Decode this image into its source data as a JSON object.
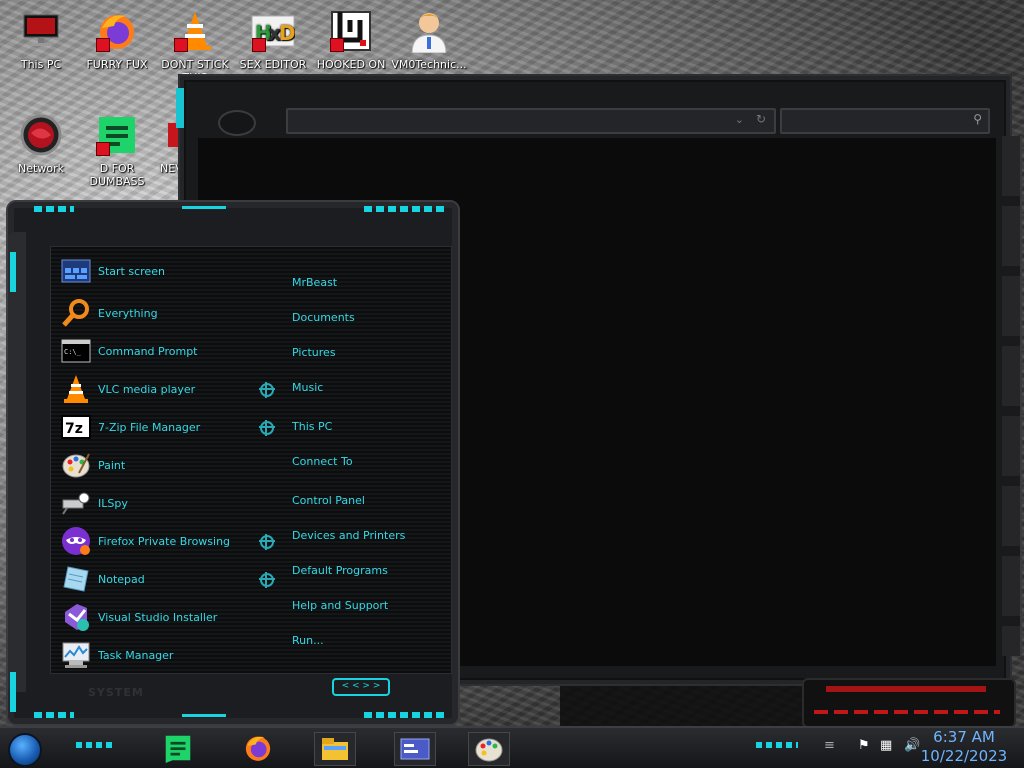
{
  "desktop": {
    "icons": [
      {
        "label": "This PC"
      },
      {
        "label": "FURRY FUX"
      },
      {
        "label": "DONT STICK THIS"
      },
      {
        "label": "SEX EDITOR"
      },
      {
        "label": "HOOKED ON"
      },
      {
        "label": "VM0Technic..."
      },
      {
        "label": "Network"
      },
      {
        "label": "D FOR DUMBASS"
      },
      {
        "label": "NEV"
      }
    ]
  },
  "start_menu": {
    "programs": [
      {
        "label": "Start screen",
        "icon": "start-screen-icon"
      },
      {
        "label": "Everything",
        "icon": "magnifier-icon"
      },
      {
        "label": "Command Prompt",
        "icon": "terminal-icon"
      },
      {
        "label": "VLC media player",
        "icon": "vlc-cone-icon",
        "submenu": true
      },
      {
        "label": "7-Zip File Manager",
        "icon": "7zip-icon",
        "submenu": true
      },
      {
        "label": "Paint",
        "icon": "palette-icon"
      },
      {
        "label": "ILSpy",
        "icon": "ilspy-icon"
      },
      {
        "label": "Firefox Private Browsing",
        "icon": "private-mask-icon",
        "submenu": true
      },
      {
        "label": "Notepad",
        "icon": "notepad-icon",
        "submenu": true
      },
      {
        "label": "Visual Studio Installer",
        "icon": "vs-installer-icon"
      },
      {
        "label": "Task Manager",
        "icon": "task-manager-icon"
      }
    ],
    "places": [
      {
        "label": "MrBeast"
      },
      {
        "label": "Documents"
      },
      {
        "label": "Pictures"
      },
      {
        "label": "Music"
      },
      {
        "label": "This PC"
      },
      {
        "label": "Connect To"
      },
      {
        "label": "Control Panel"
      },
      {
        "label": "Devices and Printers"
      },
      {
        "label": "Default Programs"
      },
      {
        "label": "Help and Support"
      },
      {
        "label": "Run..."
      }
    ],
    "footer_label": "SYSTEM",
    "footer_arrows": "< < > >"
  },
  "taskbar": {
    "time": "6:37 AM",
    "date": "10/22/2023",
    "apps": [
      "d-for-dumbass-icon",
      "firefox-icon",
      "file-explorer-icon",
      "control-panel-icon",
      "paint-icon"
    ]
  },
  "colors": {
    "accent": "#18d4e0",
    "menu_text": "#35d8e6",
    "clock": "#6fb5ff"
  }
}
